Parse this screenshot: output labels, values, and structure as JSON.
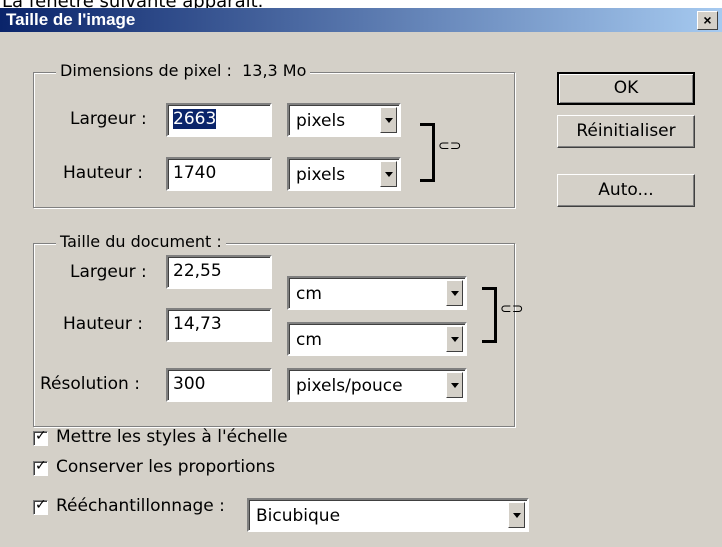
{
  "caption": "La fenêtre suivante apparaît.",
  "dialog": {
    "title": "Taille de l'image",
    "close_glyph": "×",
    "pixel_group": {
      "legend": "Dimensions de pixel :",
      "size": "13,3 Mo",
      "width_label": "Largeur :",
      "width_value": "2663",
      "width_unit": "pixels",
      "height_label": "Hauteur :",
      "height_value": "1740",
      "height_unit": "pixels"
    },
    "doc_group": {
      "legend": "Taille du document :",
      "width_label": "Largeur :",
      "width_value": "22,55",
      "width_unit": "cm",
      "height_label": "Hauteur :",
      "height_value": "14,73",
      "height_unit": "cm",
      "resolution_label": "Résolution :",
      "resolution_value": "300",
      "resolution_unit": "pixels/pouce"
    },
    "buttons": {
      "ok": "OK",
      "reset": "Réinitialiser",
      "auto": "Auto..."
    },
    "options": {
      "scale_styles": "Mettre les styles à l'échelle",
      "constrain": "Conserver les proportions",
      "resample_label": "Rééchantillonnage :",
      "resample_value": "Bicubique"
    },
    "link_icon": "link-icon"
  }
}
